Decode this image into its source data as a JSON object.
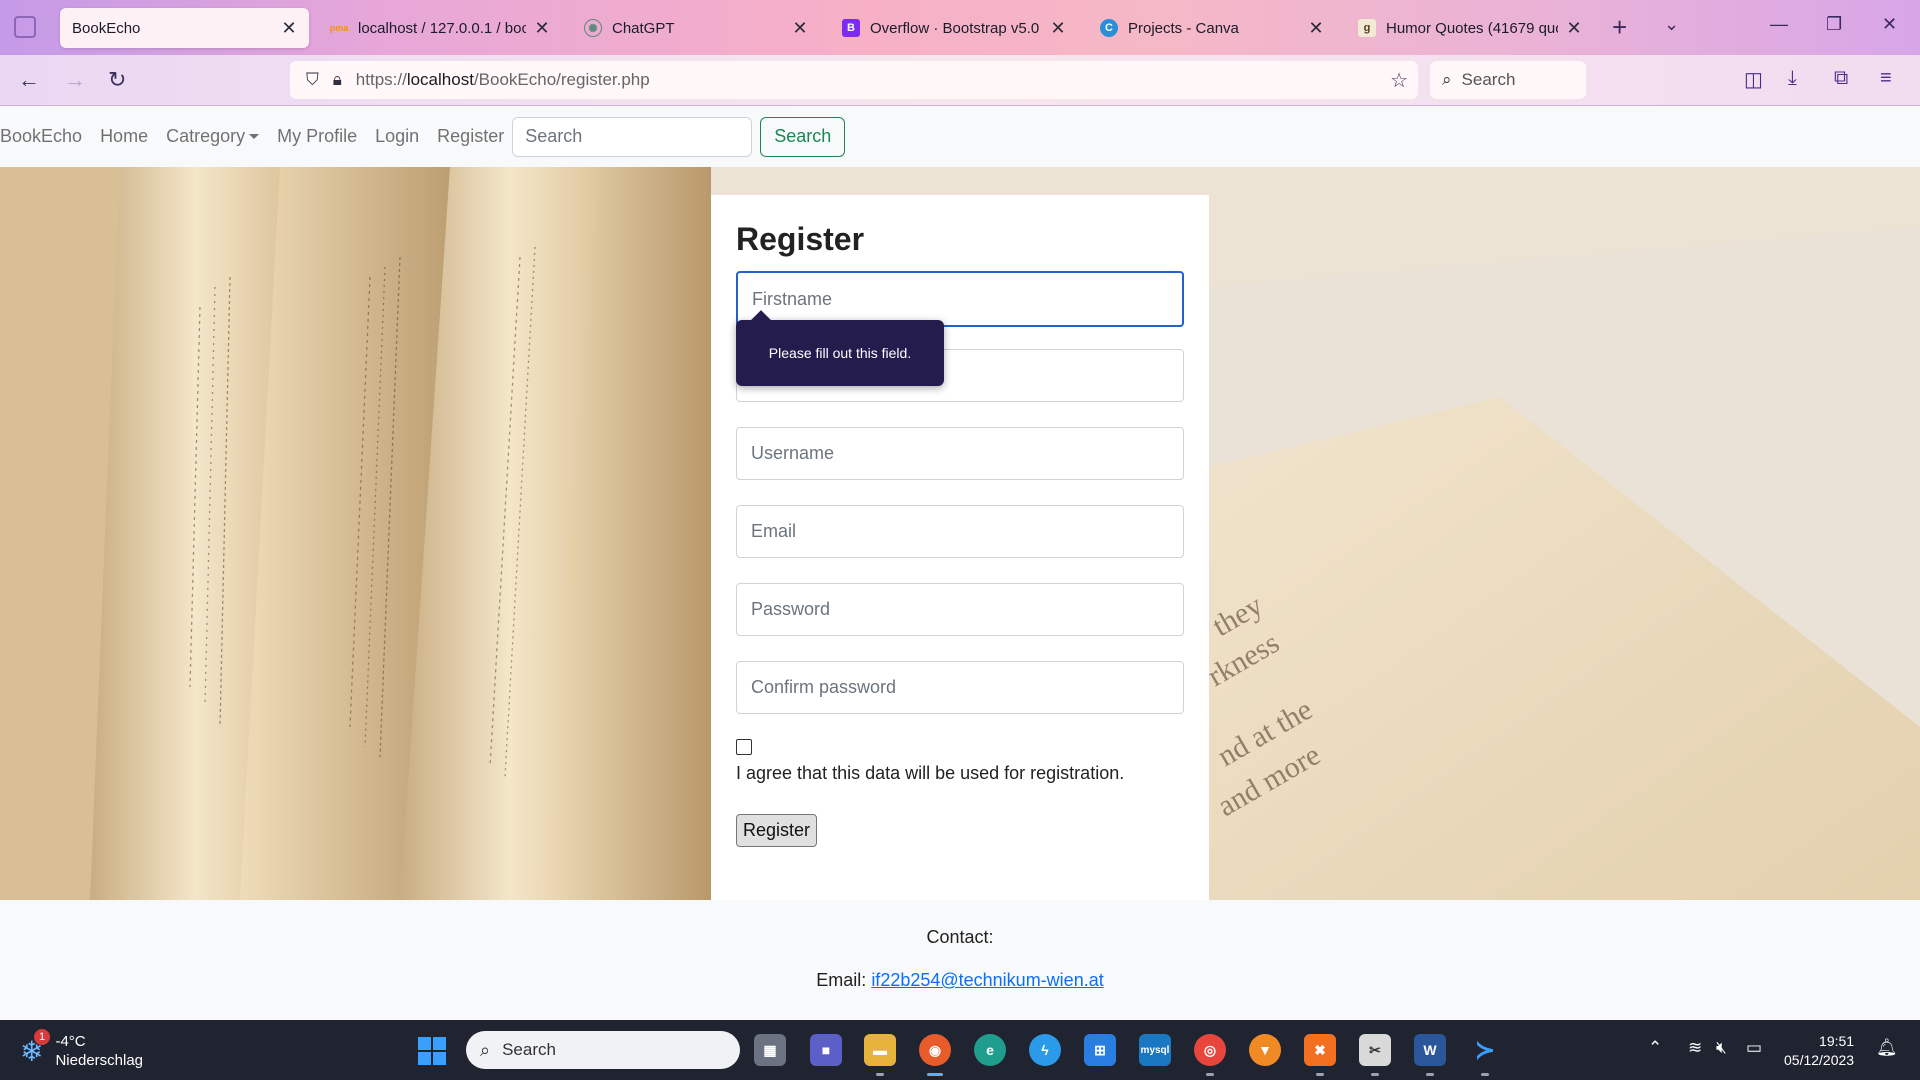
{
  "browser": {
    "tabs": [
      {
        "label": "BookEcho",
        "favicon": "page-icon",
        "active": true
      },
      {
        "label": "localhost / 127.0.0.1 / book",
        "favicon": "phpmyadmin-icon"
      },
      {
        "label": "ChatGPT",
        "favicon": "chatgpt-icon"
      },
      {
        "label": "Overflow · Bootstrap v5.0",
        "favicon": "bootstrap-icon"
      },
      {
        "label": "Projects - Canva",
        "favicon": "canva-icon"
      },
      {
        "label": "Humor Quotes (41679 quot",
        "favicon": "goodreads-icon"
      }
    ],
    "url_prefix": "https://",
    "url_host": "localhost",
    "url_path": "/BookEcho/register.php",
    "search_placeholder": "Search"
  },
  "site": {
    "brand": "BookEcho",
    "nav": {
      "home": "Home",
      "category": "Catregory",
      "profile": "My Profile",
      "login": "Login",
      "register": "Register"
    },
    "search_placeholder": "Search",
    "search_button": "Search"
  },
  "register": {
    "title": "Register",
    "firstname_placeholder": "Firstname",
    "lastname_placeholder": "",
    "username_placeholder": "Username",
    "email_placeholder": "Email",
    "password_placeholder": "Password",
    "confirm_placeholder": "Confirm password",
    "agree_label": "I agree that this data will be used for registration.",
    "agree_checked": false,
    "submit_label": "Register",
    "validation_tooltip": "Please fill out this field."
  },
  "footer": {
    "contact_label": "Contact:",
    "email_label": "Email:",
    "email_value": "if22b254@technikum-wien.at"
  },
  "taskbar": {
    "weather_temp": "-4°C",
    "weather_desc": "Niederschlag",
    "weather_badge": "1",
    "search_placeholder": "Search",
    "time": "19:51",
    "date": "05/12/2023"
  },
  "colors": {
    "nav_search_button": "#198754",
    "focus_border": "#2363c9",
    "tooltip_bg": "#241c4d",
    "link": "#0d6efd"
  }
}
